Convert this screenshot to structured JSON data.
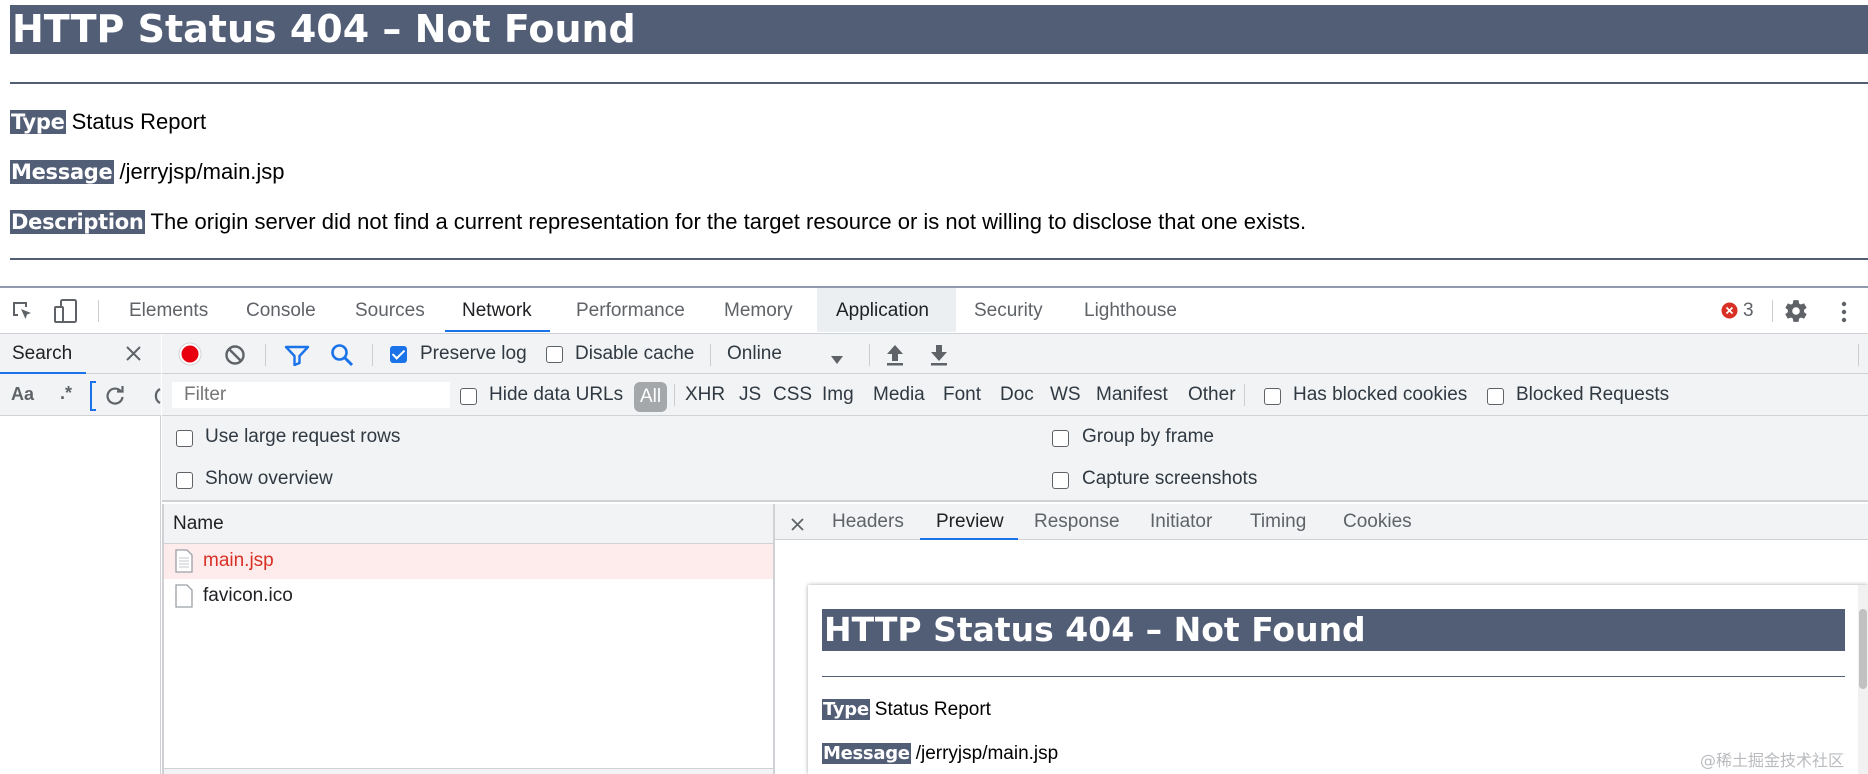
{
  "page": {
    "title": "HTTP Status 404 – Not Found",
    "type_label": "Type",
    "type_value": "Status Report",
    "message_label": "Message",
    "message_value": "/jerryjsp/main.jsp",
    "description_label": "Description",
    "description_value": "The origin server did not find a current representation for the target resource or is not willing to disclose that one exists."
  },
  "devtools": {
    "tabs": [
      "Elements",
      "Console",
      "Sources",
      "Network",
      "Performance",
      "Memory",
      "Application",
      "Security",
      "Lighthouse"
    ],
    "active_tab": "Network",
    "error_count": "3",
    "search": {
      "title": "Search",
      "match_case": "Aa",
      "regex": ".*"
    },
    "toolbar": {
      "preserve_log": "Preserve log",
      "preserve_log_checked": true,
      "disable_cache": "Disable cache",
      "throttling": "Online"
    },
    "filter": {
      "placeholder": "Filter",
      "hide_data_urls": "Hide data URLs",
      "types": [
        "All",
        "XHR",
        "JS",
        "CSS",
        "Img",
        "Media",
        "Font",
        "Doc",
        "WS",
        "Manifest",
        "Other"
      ],
      "has_blocked_cookies": "Has blocked cookies",
      "blocked_requests": "Blocked Requests"
    },
    "settings": {
      "large_rows": "Use large request rows",
      "show_overview": "Show overview",
      "group_by_frame": "Group by frame",
      "capture_screenshots": "Capture screenshots"
    },
    "requests": {
      "header": "Name",
      "rows": [
        {
          "name": "main.jsp",
          "error": true
        },
        {
          "name": "favicon.ico",
          "error": false
        }
      ]
    },
    "detail_tabs": [
      "Headers",
      "Preview",
      "Response",
      "Initiator",
      "Timing",
      "Cookies"
    ],
    "active_detail_tab": "Preview"
  },
  "preview": {
    "title": "HTTP Status 404 – Not Found",
    "type_label": "Type",
    "type_value": "Status Report",
    "message_label": "Message",
    "message_value": "/jerryjsp/main.jsp"
  },
  "watermark": "@稀土掘金技术社区",
  "colors": {
    "tomcat_header": "#525d76",
    "accent": "#1a73e8",
    "error": "#d93025",
    "selected_row": "#fdeceb"
  }
}
